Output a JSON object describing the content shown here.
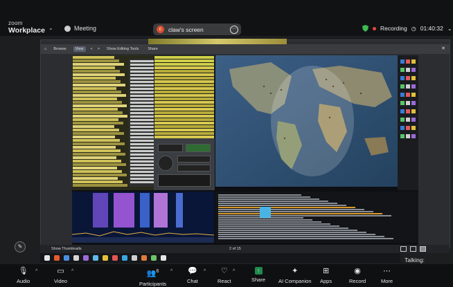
{
  "header": {
    "brand_line1": "zoom",
    "brand_line2": "Workplace",
    "meeting_label": "Meeting",
    "share_initial": "c",
    "share_title": "claw's screen",
    "recording_label": "Recording",
    "timer": "01:40:32"
  },
  "shared_window": {
    "toolbar": {
      "browse": "Browse",
      "view": "View",
      "back": "<",
      "forward": ">",
      "show_editing": "Show Editing Tools",
      "share": "Share"
    },
    "thumbnail_label": "Show Thumbnails",
    "page_indicator": "2 of 15"
  },
  "overlay": {
    "talking_label": "Talking:"
  },
  "toolbar": {
    "audio": "Audio",
    "video": "Video",
    "participants": "Participants",
    "participants_count": "6",
    "chat": "Chat",
    "react": "React",
    "share": "Share",
    "ai_companion": "AI Companion",
    "apps": "Apps",
    "record": "Record",
    "more": "More"
  },
  "colors": {
    "accent_green": "#3fb950",
    "recording_red": "#e5483c",
    "share_green": "#1f8a4c",
    "cluster_yellow": "#b8ad3a",
    "spot_yellow": "#d8c94f"
  }
}
